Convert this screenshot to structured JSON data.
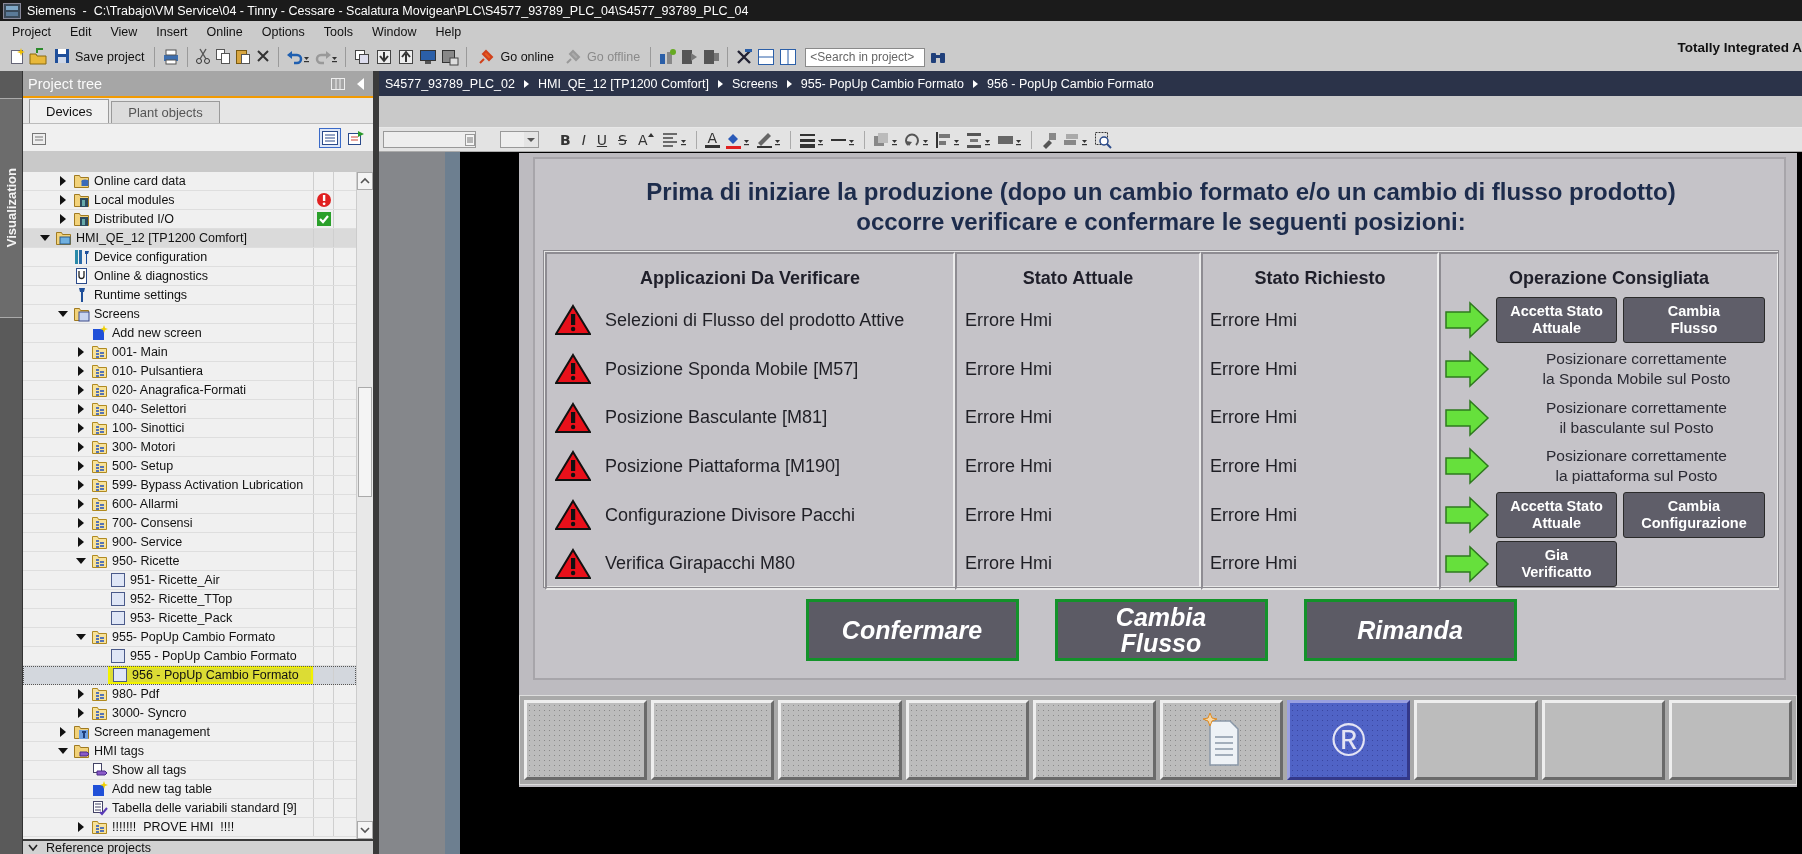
{
  "window": {
    "title": "Siemens  -  C:\\Trabajo\\VM Service\\04 - Tinny - Cessare - Scalatura Movigear\\PLC\\S4577_93789_PLC_04\\S4577_93789_PLC_04"
  },
  "menu": [
    "Project",
    "Edit",
    "View",
    "Insert",
    "Online",
    "Options",
    "Tools",
    "Window",
    "Help"
  ],
  "toolbar": {
    "buttons": [
      {
        "label": "Save project",
        "disabled": false
      },
      {
        "label": "Go online",
        "disabled": false
      },
      {
        "label": "Go offline",
        "disabled": true
      }
    ],
    "search": {
      "placeholder": "<Search in project>"
    }
  },
  "brand": "Totally Integrated A",
  "side_tab": {
    "label": "Visualization"
  },
  "project_tree": {
    "title": "Project tree",
    "tabs": [
      {
        "label": "Devices",
        "selected": true
      },
      {
        "label": "Plant objects",
        "selected": false
      }
    ],
    "partial_branch": [
      {
        "label": "Online card data",
        "kind": "db-folder",
        "expanded": false,
        "selected": false
      },
      {
        "label": "Local modules",
        "kind": "module-folder",
        "expanded": false,
        "selected": false,
        "error": true
      },
      {
        "label": "Distributed I/O",
        "kind": "module-folder",
        "expanded": false,
        "selected": false,
        "ok": true
      }
    ],
    "items": [
      {
        "label": "HMI_QE_12 [TP1200 Comfort]",
        "kind": "hmi-device",
        "expanded": true,
        "selected": false,
        "children": [
          {
            "label": "Device configuration",
            "kind": "device-config",
            "selected": false
          },
          {
            "label": "Online & diagnostics",
            "kind": "diagnostics",
            "selected": false
          },
          {
            "label": "Runtime settings",
            "kind": "runtime",
            "selected": false
          },
          {
            "label": "Screens",
            "kind": "screens-folder",
            "expanded": true,
            "selected": false,
            "children": [
              {
                "label": "Add new screen",
                "kind": "add-new",
                "selected": false
              },
              {
                "label": "001- Main",
                "kind": "screen-group",
                "expanded": false,
                "selected": false
              },
              {
                "label": "010- Pulsantiera",
                "kind": "screen-group",
                "expanded": false,
                "selected": false
              },
              {
                "label": "020- Anagrafica-Formati",
                "kind": "screen-group",
                "expanded": false,
                "selected": false
              },
              {
                "label": "040- Selettori",
                "kind": "screen-group",
                "expanded": false,
                "selected": false
              },
              {
                "label": "100- Sinottici",
                "kind": "screen-group",
                "expanded": false,
                "selected": false
              },
              {
                "label": "300- Motori",
                "kind": "screen-group",
                "expanded": false,
                "selected": false
              },
              {
                "label": "500- Setup",
                "kind": "screen-group",
                "expanded": false,
                "selected": false
              },
              {
                "label": "599- Bypass Activation Lubrication",
                "kind": "screen-group",
                "expanded": false,
                "selected": false
              },
              {
                "label": "600- Allarmi",
                "kind": "screen-group",
                "expanded": false,
                "selected": false
              },
              {
                "label": "700- Consensi",
                "kind": "screen-group",
                "expanded": false,
                "selected": false
              },
              {
                "label": "900- Service",
                "kind": "screen-group",
                "expanded": false,
                "selected": false
              },
              {
                "label": "950- Ricette",
                "kind": "screen-group",
                "expanded": true,
                "selected": false,
                "children": [
                  {
                    "label": "951- Ricette_Air",
                    "kind": "screen",
                    "selected": false
                  },
                  {
                    "label": "952- Ricette_TTop",
                    "kind": "screen",
                    "selected": false
                  },
                  {
                    "label": "953- Ricette_Pack",
                    "kind": "screen",
                    "selected": false
                  }
                ]
              },
              {
                "label": "955- PopUp Cambio Formato",
                "kind": "screen-group",
                "expanded": true,
                "selected": false,
                "children": [
                  {
                    "label": "955 - PopUp Cambio Formato",
                    "kind": "screen",
                    "selected": false
                  },
                  {
                    "label": "956 - PopUp Cambio Formato",
                    "kind": "screen",
                    "selected": true
                  }
                ]
              },
              {
                "label": "980- Pdf",
                "kind": "screen-group",
                "expanded": false,
                "selected": false
              },
              {
                "label": "3000- Syncro",
                "kind": "screen-group",
                "expanded": false,
                "selected": false
              }
            ]
          },
          {
            "label": "Screen management",
            "kind": "management-folder",
            "expanded": false,
            "selected": false
          },
          {
            "label": "HMI tags",
            "kind": "tags-folder",
            "expanded": true,
            "selected": false,
            "children": [
              {
                "label": "Show all tags",
                "kind": "show-tags",
                "selected": false
              },
              {
                "label": "Add new tag table",
                "kind": "add-new",
                "selected": false
              },
              {
                "label": "Tabella delle variabili standard [9]",
                "kind": "tag-table",
                "selected": false
              },
              {
                "label": "!!!!!!!  PROVE HMI  !!!!",
                "kind": "screen-group",
                "expanded": false,
                "selected": false
              }
            ]
          }
        ]
      }
    ]
  },
  "reference_projects": {
    "label": "Reference projects"
  },
  "breadcrumb": [
    "S4577_93789_PLC_02",
    "HMI_QE_12 [TP1200 Comfort]",
    "Screens",
    "955- PopUp Cambio Formato",
    "956 - PopUp Cambio Formato"
  ],
  "format_toolbar": {
    "text_buttons": [
      {
        "label": "B",
        "kind": "bold"
      },
      {
        "label": "I",
        "kind": "italic"
      },
      {
        "label": "U",
        "kind": "underline"
      },
      {
        "label": "S",
        "kind": "strike"
      },
      {
        "label": "A",
        "kind": "grow"
      },
      {
        "label": "A",
        "kind": "color"
      }
    ]
  },
  "popup": {
    "heading": "Prima di iniziare la produzione (dopo un cambio formato e/o un cambio di flusso prodotto)\noccorre verificare e confermare le seguenti posizioni:",
    "columns": [
      "Applicazioni Da Verificare",
      "Stato Attuale",
      "Stato Richiesto",
      "Operazione Consigliata"
    ],
    "rows": [
      {
        "application": "Selezioni di Flusso del prodotto Attive",
        "current": "Errore Hmi",
        "required": "Errore Hmi",
        "action": {
          "kind": "buttons",
          "buttons": [
            "Accetta Stato\nAttuale",
            "Cambia\nFlusso"
          ]
        }
      },
      {
        "application": "Posizione Sponda Mobile [M57]",
        "current": "Errore Hmi",
        "required": "Errore Hmi",
        "action": {
          "kind": "text",
          "text": "Posizionare correttamente\nla Sponda Mobile sul Posto"
        }
      },
      {
        "application": "Posizione Basculante [M81]",
        "current": "Errore Hmi",
        "required": "Errore Hmi",
        "action": {
          "kind": "text",
          "text": "Posizionare correttamente\nil basculante sul Posto"
        }
      },
      {
        "application": "Posizione Piattaforma [M190]",
        "current": "Errore Hmi",
        "required": "Errore Hmi",
        "action": {
          "kind": "text",
          "text": "Posizionare correttamente\nla piattaforma sul Posto"
        }
      },
      {
        "application": "Configurazione Divisore Pacchi",
        "current": "Errore Hmi",
        "required": "Errore Hmi",
        "action": {
          "kind": "buttons",
          "buttons": [
            "Accetta Stato\nAttuale",
            "Cambia\nConfigurazione"
          ]
        }
      },
      {
        "application": "Verifica Girapacchi M80",
        "current": "Errore Hmi",
        "required": "Errore Hmi",
        "action": {
          "kind": "buttons",
          "buttons": [
            "Gia\nVerificatto"
          ]
        }
      }
    ],
    "buttons": [
      "Confermare",
      "Cambia\nFlusso",
      "Rimanda"
    ]
  },
  "function_keys": [
    {
      "kind": "blank"
    },
    {
      "kind": "blank"
    },
    {
      "kind": "blank"
    },
    {
      "kind": "blank"
    },
    {
      "kind": "blank"
    },
    {
      "kind": "new-document"
    },
    {
      "kind": "symbol",
      "symbol": "®"
    },
    {
      "kind": "plain"
    },
    {
      "kind": "plain"
    },
    {
      "kind": "plain"
    }
  ]
}
